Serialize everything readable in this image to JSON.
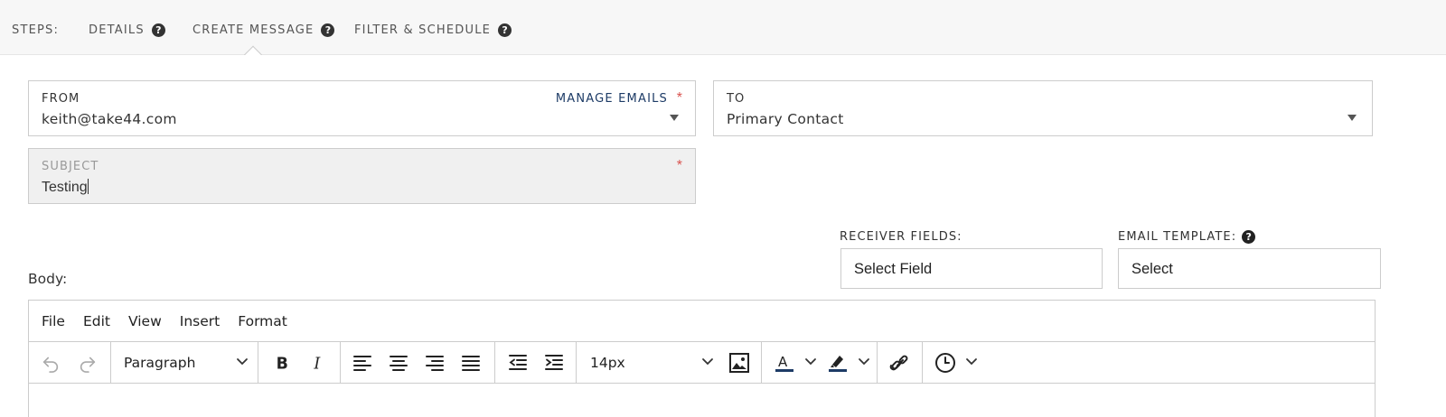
{
  "steps": {
    "label": "STEPS:",
    "items": [
      {
        "label": "DETAILS",
        "help": "?"
      },
      {
        "label": "CREATE MESSAGE",
        "help": "?"
      },
      {
        "label": "FILTER & SCHEDULE",
        "help": "?"
      }
    ]
  },
  "from": {
    "label": "FROM",
    "value": "keith@take44.com",
    "manage_link": "MANAGE EMAILS",
    "required": "*"
  },
  "to": {
    "label": "TO",
    "value": "Primary Contact"
  },
  "subject": {
    "label": "SUBJECT",
    "value": "Testing",
    "required": "*"
  },
  "receiver_fields": {
    "label": "RECEIVER FIELDS:",
    "value": "Select Field"
  },
  "email_template": {
    "label": "EMAIL TEMPLATE:",
    "help": "?",
    "value": "Select"
  },
  "body": {
    "label": "Body:"
  },
  "editor": {
    "menu": [
      "File",
      "Edit",
      "View",
      "Insert",
      "Format"
    ],
    "block_format": "Paragraph",
    "font_size": "14px",
    "icons": [
      "undo-icon",
      "redo-icon",
      "bold-icon",
      "italic-icon",
      "align-left-icon",
      "align-center-icon",
      "align-right-icon",
      "justify-icon",
      "outdent-icon",
      "indent-icon",
      "image-icon",
      "text-color-icon",
      "highlight-icon",
      "link-icon",
      "clock-icon"
    ],
    "text_color": "#1d3b66",
    "highlight_color": "#1d3b66"
  },
  "colors": {
    "link": "#1d3b66",
    "required": "#d9534f",
    "border": "#cccccc"
  }
}
